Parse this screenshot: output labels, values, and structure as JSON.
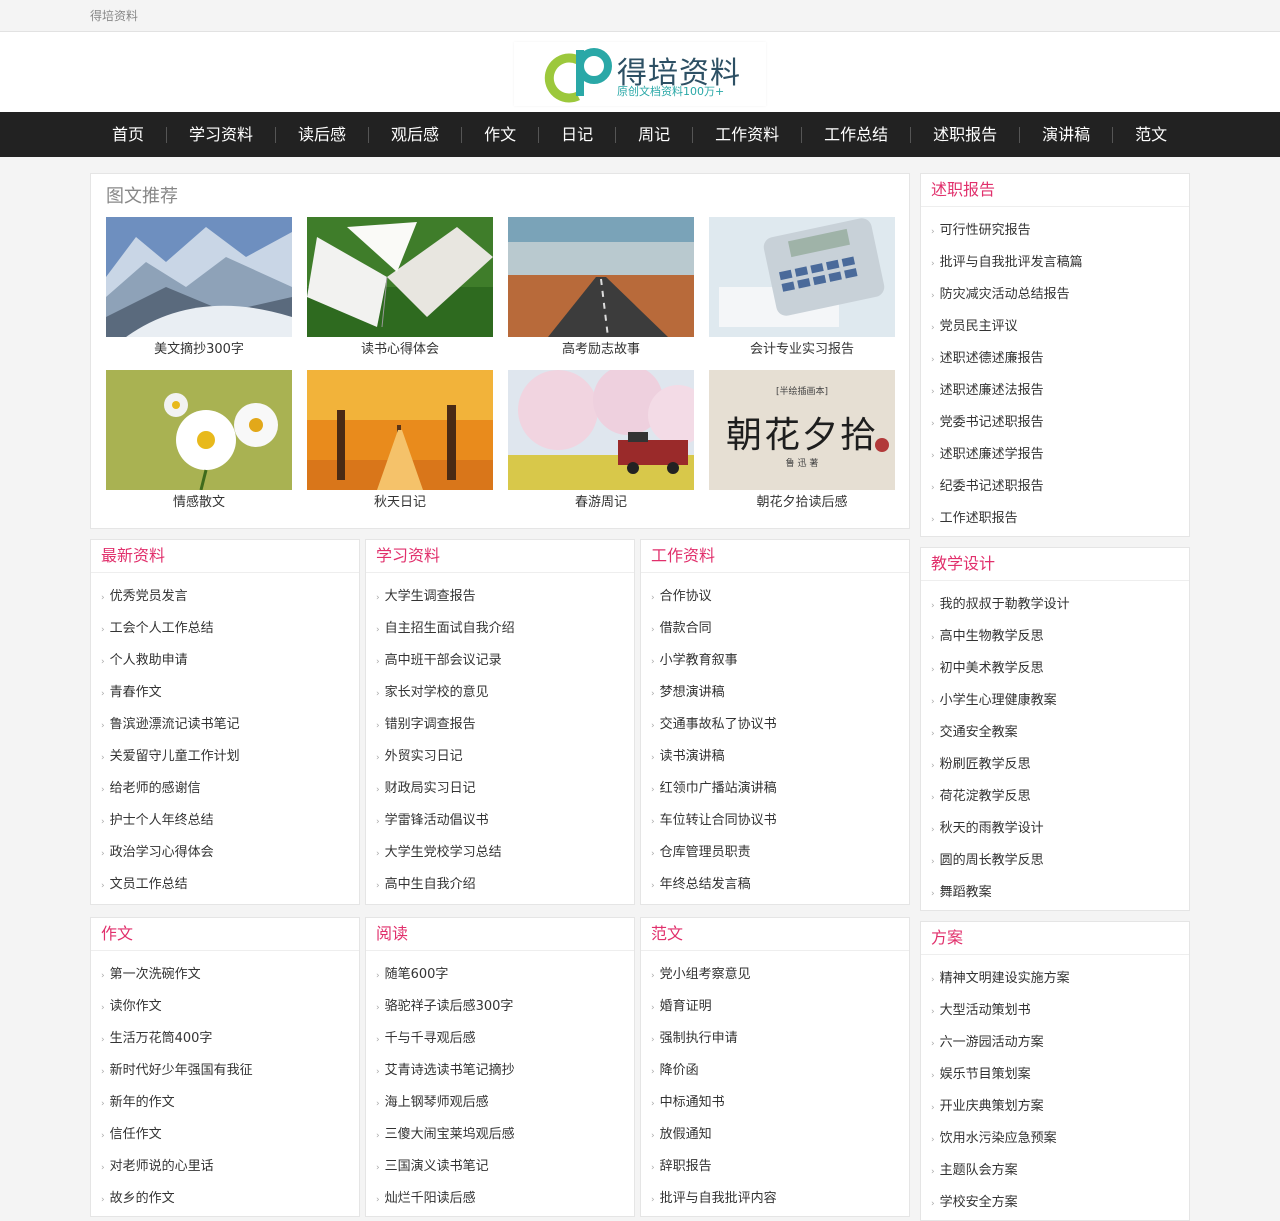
{
  "topbar": {
    "site_name": "得培资料"
  },
  "logo": {
    "name": "得培资料",
    "slogan": "原创文档资料100万+"
  },
  "nav": [
    "首页",
    "学习资料",
    "读后感",
    "观后感",
    "作文",
    "日记",
    "周记",
    "工作资料",
    "工作总结",
    "述职报告",
    "演讲稿",
    "范文"
  ],
  "featured": {
    "title": "图文推荐",
    "items": [
      "美文摘抄300字",
      "读书心得体会",
      "高考励志故事",
      "会计专业实习报告",
      "情感散文",
      "秋天日记",
      "春游周记",
      "朝花夕拾读后感"
    ],
    "book_cover_text": "朝花夕拾",
    "book_cover_small": "[半绘插画本]",
    "book_cover_author": "鲁 迅 著"
  },
  "sections": {
    "latest": {
      "title": "最新资料",
      "items": [
        "优秀党员发言",
        "工会个人工作总结",
        "个人救助申请",
        "青春作文",
        "鲁滨逊漂流记读书笔记",
        "关爱留守儿童工作计划",
        "给老师的感谢信",
        "护士个人年终总结",
        "政治学习心得体会",
        "文员工作总结"
      ]
    },
    "study": {
      "title": "学习资料",
      "items": [
        "大学生调查报告",
        "自主招生面试自我介绍",
        "高中班干部会议记录",
        "家长对学校的意见",
        "错别字调查报告",
        "外贸实习日记",
        "财政局实习日记",
        "学雷锋活动倡议书",
        "大学生党校学习总结",
        "高中生自我介绍"
      ]
    },
    "work": {
      "title": "工作资料",
      "items": [
        "合作协议",
        "借款合同",
        "小学教育叙事",
        "梦想演讲稿",
        "交通事故私了协议书",
        "读书演讲稿",
        "红领巾广播站演讲稿",
        "车位转让合同协议书",
        "仓库管理员职责",
        "年终总结发言稿"
      ]
    },
    "essay": {
      "title": "作文",
      "items": [
        "第一次洗碗作文",
        "读你作文",
        "生活万花筒400字",
        "新时代好少年强国有我征",
        "新年的作文",
        "信任作文",
        "对老师说的心里话",
        "故乡的作文"
      ]
    },
    "reading": {
      "title": "阅读",
      "items": [
        "随笔600字",
        "骆驼祥子读后感300字",
        "千与千寻观后感",
        "艾青诗选读书笔记摘抄",
        "海上钢琴师观后感",
        "三傻大闹宝莱坞观后感",
        "三国演义读书笔记",
        "灿烂千阳读后感"
      ]
    },
    "model": {
      "title": "范文",
      "items": [
        "党小组考察意见",
        "婚育证明",
        "强制执行申请",
        "降价函",
        "中标通知书",
        "放假通知",
        "辞职报告",
        "批评与自我批评内容"
      ]
    },
    "report": {
      "title": "述职报告",
      "items": [
        "可行性研究报告",
        "批评与自我批评发言稿篇",
        "防灾减灾活动总结报告",
        "党员民主评议",
        "述职述德述廉报告",
        "述职述廉述法报告",
        "党委书记述职报告",
        "述职述廉述学报告",
        "纪委书记述职报告",
        "工作述职报告"
      ]
    },
    "teaching": {
      "title": "教学设计",
      "items": [
        "我的叔叔于勒教学设计",
        "高中生物教学反思",
        "初中美术教学反思",
        "小学生心理健康教案",
        "交通安全教案",
        "粉刷匠教学反思",
        "荷花淀教学反思",
        "秋天的雨教学设计",
        "圆的周长教学反思",
        "舞蹈教案"
      ]
    },
    "plan": {
      "title": "方案",
      "items": [
        "精神文明建设实施方案",
        "大型活动策划书",
        "六一游园活动方案",
        "娱乐节目策划案",
        "开业庆典策划方案",
        "饮用水污染应急预案",
        "主题队会方案",
        "学校安全方案"
      ]
    }
  },
  "colors": {
    "accent": "#e1306c",
    "nav_bg": "#222222",
    "logo_teal": "#2aa8a7",
    "logo_green": "#9cc83c"
  }
}
